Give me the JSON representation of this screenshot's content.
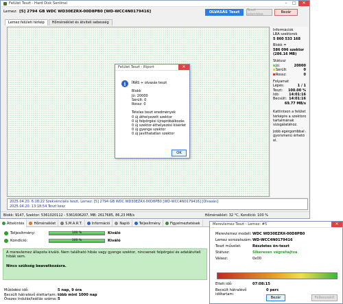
{
  "main": {
    "title": "Felület Teszt - Hard Disk Sentinel",
    "drive_label": "Lemez:",
    "drive": "[5] 2794 GB  WDC WD30EZRX-00D8PB0 [WD-WCC4N0179416]",
    "status": "OLVASÁS Teszt",
    "btn_report": "Teszt jelentése",
    "btn_close": "Bezár",
    "tabs": [
      "Lemez felületi térkép",
      "Hőmérséklet és átviteli sebesség"
    ],
    "side": {
      "info_title": "Információk",
      "lba_label": "LBA szektorok",
      "lba_value": "5 860 533 168",
      "block_label": "Blokk =",
      "block_value": "586 096 szektor",
      "block_size": "(286.16 MB)",
      "status_title": "Státusz",
      "ok_label": "Jó:",
      "ok_value": "20000",
      "damaged_label": "Sérült:",
      "damaged_value": "0",
      "bad_label": "Rossz:",
      "bad_value": "0",
      "progress_title": "Folyamat",
      "step_label": "Lépés:",
      "step_value": "1 / 1",
      "test_label": "Teszt:",
      "test_value": "100.00 %",
      "time_label": "Idő:",
      "time_value": "14:01:16",
      "est_label": "Becsült:",
      "est_value": "14:01:16",
      "speed_value": "69.77 MB/s",
      "help1": "Kattintson a felületi",
      "help2": "térképre a szektorok",
      "help3": "tartalmának",
      "help4": "vizsgálatához.",
      "help5": "Jobb egérgombbal a",
      "help6": "gyorsmenü érhető",
      "help7": "el."
    },
    "log": [
      "2025.04.20.  6:18:22  Szekvenciális teszt, Lemez: [5] 2794 GB  WDC WD30EZRX-00D8PB0 [WD-WCC4N0179416] [Olvasás]",
      "2025.04.20.  13:18:54   Teszt kész"
    ],
    "statusbar_left": "Blokk: 9147, Szektor: 5361020112 - 5361606207, MB: 2617685, 86,23 MB/s",
    "statusbar_right": "Hőmérséklet: 32 °C,  Kondíció: 100 %"
  },
  "report": {
    "title": "Felület Teszt - Riport",
    "icon_glyph": "i",
    "lines": [
      "ÍRÁS + olvasás teszt",
      "",
      "Blokk",
      "   Jó: 20000",
      "   Sérült: 0",
      "   Rossz: 0",
      "",
      "Tételes teszt eredmények",
      "   0 új áthelyezett szektor",
      "   0 új felpörgési újrapróbálkozás",
      "   0 új szektor-áthelyezési kísérlet",
      "   0 új gyenge szektor",
      "   0 új javíthatatlan szektor"
    ],
    "ok_label": "OK"
  },
  "bottom": {
    "tabs": [
      "Áttekintés",
      "Hőmérséklet",
      "S.M.A.R.T.",
      "Információ",
      "Napló",
      "Teljesítmény",
      "Figyelmeztetések"
    ],
    "health_label": "Teljesítmény:",
    "health_value": "100 %",
    "health_grade": "Kiváló",
    "health_fraction": 1.0,
    "condition_label": "Kondíció:",
    "condition_value": "100 %",
    "condition_grade": "Kiváló",
    "condition_fraction": 1.0,
    "message1": "A merevlemez állapota kiváló. Nem található hibás vagy gyenge szektor, nincsenek felpörgési és adatátviteli hibák sem.",
    "message2": "Nincs szükség beavatkozásra.",
    "stats": [
      {
        "k": "Működési idő:",
        "v": "5 nap, 9 óra"
      },
      {
        "k": "Becsült hátralévő élettartam:",
        "v": "több mint 1000 nap"
      },
      {
        "k": "Összes indulás/leállás száma:",
        "v": "5"
      }
    ]
  },
  "test": {
    "title": "Merevlemez Teszt - Lemez: #5",
    "rows": [
      {
        "k": "Merevlemez modell:",
        "v": "WDC WD30EZRX-00D8PB0"
      },
      {
        "k": "Lemez sorozatszám:",
        "v": "WD-WCC4N0179416"
      },
      {
        "k": "Teszt művelet:",
        "v": "Részletes ön-teszt"
      },
      {
        "k": "Státusz:",
        "v": "Sikeresen végrehajtva"
      },
      {
        "k": "Válasz:",
        "v": "0x00"
      }
    ],
    "elapsed_label": "Eltelt idő:",
    "elapsed_value": "07:08:15",
    "remaining_label": "Becsült hátralévő időtartam:",
    "remaining_value": "0 perc",
    "progress_fraction": 1.0,
    "btn_close": "Bezár",
    "btn_abort": "Félbeszakít"
  }
}
